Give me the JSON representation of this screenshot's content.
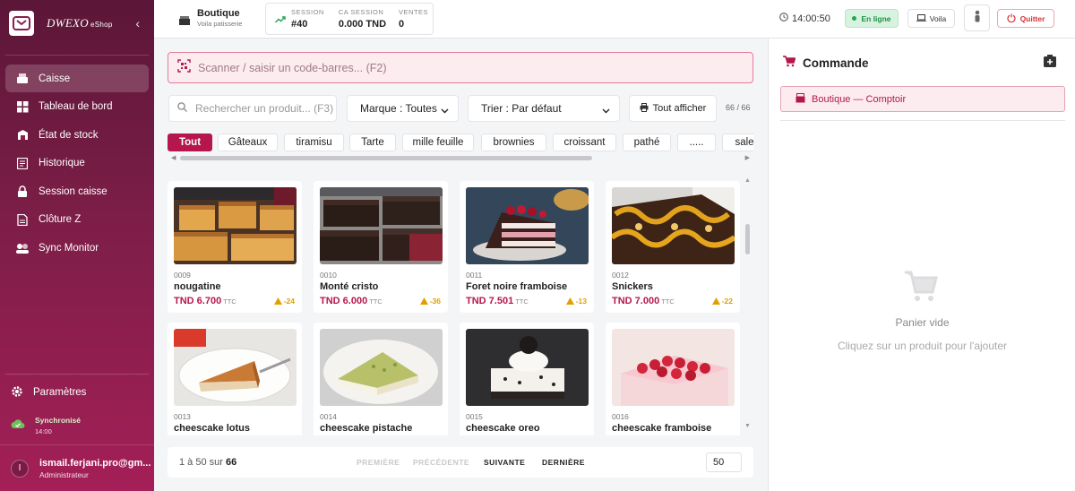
{
  "app": {
    "logo_text": "DWEXO",
    "logo_sub": "eShop"
  },
  "sidebar": {
    "items": [
      {
        "label": "Caisse",
        "icon": "register-icon",
        "active": true
      },
      {
        "label": "Tableau de bord",
        "icon": "dashboard-icon",
        "active": false
      },
      {
        "label": "État de stock",
        "icon": "stock-icon",
        "active": false
      },
      {
        "label": "Historique",
        "icon": "history-icon",
        "active": false
      },
      {
        "label": "Session caisse",
        "icon": "lock-icon",
        "active": false
      },
      {
        "label": "Clôture Z",
        "icon": "report-icon",
        "active": false
      },
      {
        "label": "Sync Monitor",
        "icon": "sync-icon",
        "active": false
      }
    ],
    "settings_label": "Paramètres",
    "sync_status": "Synchronisé",
    "sync_time": "14:00",
    "user_initial": "I",
    "user_email": "ismail.ferjani.pro@gm...",
    "user_role": "Administrateur"
  },
  "topbar": {
    "store_name": "Boutique",
    "store_sub": "Voila patisserie",
    "stats": [
      {
        "label": "SESSION",
        "value": "#40"
      },
      {
        "label": "CA SESSION",
        "value": "0.000 TND"
      },
      {
        "label": "VENTES",
        "value": "0"
      }
    ],
    "clock": "14:00:50",
    "online_label": "En ligne",
    "voila_label": "Voila",
    "quit_label": "Quitter"
  },
  "main": {
    "scan_placeholder": "Scanner / saisir un code-barres... (F2)",
    "search_placeholder": "Rechercher un produit... (F3)",
    "brand_select": "Marque : Toutes",
    "sort_select": "Trier : Par défaut",
    "show_all_label": "Tout afficher",
    "count": "66 / 66",
    "chips": [
      "Tout",
      "Gâteaux",
      "tiramisu",
      "Tarte",
      "mille feuille",
      "brownies",
      "croissant",
      "pathé",
      ".....",
      "sale"
    ],
    "currency": "TND",
    "ttc": "TTC",
    "products": [
      {
        "code": "0009",
        "name": "nougatine",
        "price": "6.700",
        "stock": "-24"
      },
      {
        "code": "0010",
        "name": "Monté cristo",
        "price": "6.000",
        "stock": "-36"
      },
      {
        "code": "0011",
        "name": "Foret noire framboise",
        "price": "7.501",
        "stock": "-13"
      },
      {
        "code": "0012",
        "name": "Snickers",
        "price": "7.000",
        "stock": "-22"
      },
      {
        "code": "0013",
        "name": "cheescake lotus"
      },
      {
        "code": "0014",
        "name": "cheescake pistache"
      },
      {
        "code": "0015",
        "name": "cheescake oreo"
      },
      {
        "code": "0016",
        "name": "cheescake framboise"
      }
    ],
    "pager": {
      "range": "1 à 50 sur",
      "total": "66",
      "first": "PREMIÈRE",
      "prev": "PRÉCÉDENTE",
      "next": "SUIVANTE",
      "last": "DERNIÈRE",
      "page_size": "50"
    }
  },
  "order": {
    "title": "Commande",
    "counter_label": "Boutique — Comptoir",
    "empty_title": "Panier vide",
    "empty_sub": "Cliquez sur un produit pour l'ajouter"
  },
  "colors": {
    "accent": "#b5174d",
    "sidebar_top": "#5b1638",
    "sidebar_bottom": "#a41f57",
    "online": "#22a552",
    "quit": "#d63434",
    "stock_warn": "#e0a000"
  }
}
